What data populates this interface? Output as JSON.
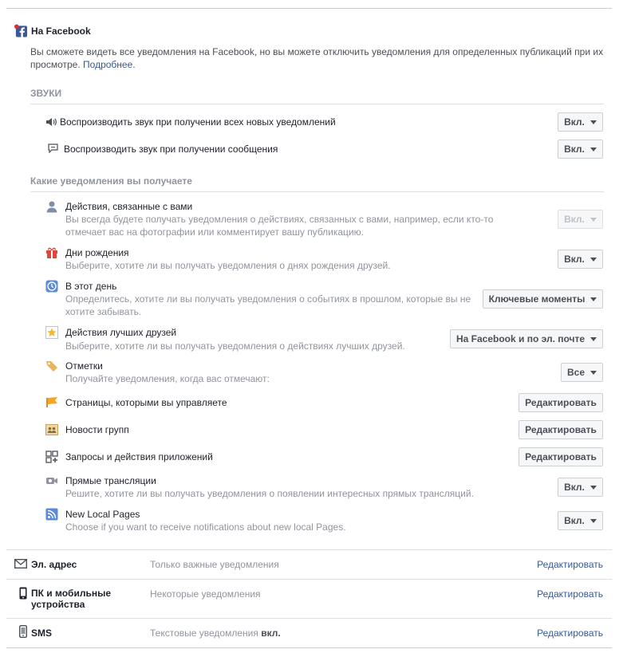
{
  "header": {
    "title": "На Facebook",
    "description": "Вы сможете видеть все уведомления на Facebook, но вы можете отключить уведомления для определенных публикаций при их просмотре.",
    "description_link": "Подробнее."
  },
  "sounds": {
    "heading": "ЗВУКИ",
    "items": [
      {
        "icon": "speaker-icon",
        "label": "Воспроизводить звук при получении всех новых уведомлений",
        "button": "Вкл."
      },
      {
        "icon": "message-icon",
        "label": "Воспроизводить звук при получении сообщения",
        "button": "Вкл."
      }
    ]
  },
  "notifications": {
    "heading": "Какие уведомления вы получаете",
    "items": [
      {
        "icon": "user-icon",
        "title": "Действия, связанные с вами",
        "desc": "Вы всегда будете получать уведомления о действиях, связанных с вами, например, если кто-то отмечает вас на фотографии или комментирует вашу публикацию.",
        "button": "Вкл.",
        "disabled": true
      },
      {
        "icon": "gift-icon",
        "title": "Дни рождения",
        "desc": "Выберите, хотите ли вы получать уведомления о днях рождения друзей.",
        "button": "Вкл."
      },
      {
        "icon": "clock-icon",
        "title": "В этот день",
        "desc": "Определитесь, хотите ли вы получать уведомления о событиях в прошлом, которые вы не хотите забывать.",
        "button": "Ключевые моменты"
      },
      {
        "icon": "star-icon",
        "title": "Действия лучших друзей",
        "desc": "Выберите, хотите ли вы получать уведомления о действиях лучших друзей.",
        "button": "На Facebook и по эл. почте"
      },
      {
        "icon": "tag-icon",
        "title": "Отметки",
        "desc": "Получайте уведомления, когда вас отмечают:",
        "button": "Все"
      },
      {
        "icon": "flag-icon",
        "title": "Страницы, которыми вы управляете",
        "button": "Редактировать"
      },
      {
        "icon": "group-icon",
        "title": "Новости групп",
        "button": "Редактировать"
      },
      {
        "icon": "apps-icon",
        "title": "Запросы и действия приложений",
        "button": "Редактировать"
      },
      {
        "icon": "video-icon",
        "title": "Прямые трансляции",
        "desc": "Решите, хотите ли вы получать уведомления о появлении интересных прямых трансляций.",
        "button": "Вкл."
      },
      {
        "icon": "rss-icon",
        "title": "New Local Pages",
        "desc": "Choose if you want to receive notifications about new local Pages.",
        "button": "Вкл."
      }
    ]
  },
  "channels": [
    {
      "icon": "envelope-icon",
      "label": "Эл. адрес",
      "status": "Только важные уведомления",
      "action": "Редактировать"
    },
    {
      "icon": "desktop-mobile-icon",
      "label": "ПК и мобильные устройства",
      "status": "Некоторые уведомления",
      "action": "Редактировать"
    },
    {
      "icon": "phone-icon",
      "label": "SMS",
      "status": "Текстовые уведомления",
      "status_bold": "вкл.",
      "action": "Редактировать"
    }
  ],
  "colors": {
    "accent": "#365899",
    "facebook_blue": "#3b5998",
    "muted": "#90949c"
  }
}
